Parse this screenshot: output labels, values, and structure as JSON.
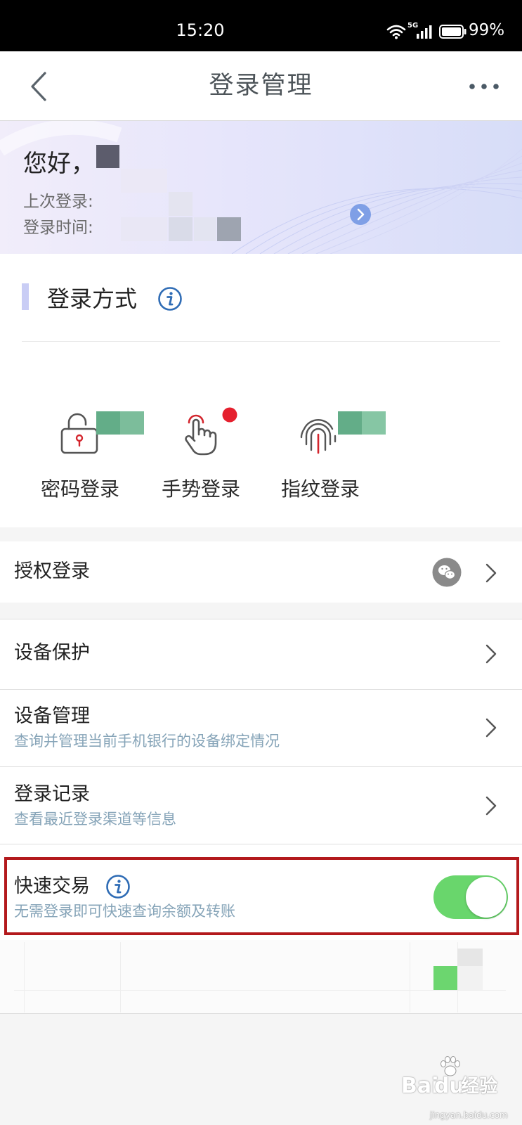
{
  "status_bar": {
    "time": "15:20",
    "network": "5G",
    "battery": "99%"
  },
  "header": {
    "title": "登录管理",
    "back_icon": "chevron-left-icon",
    "more_icon": "more-dots-icon"
  },
  "banner": {
    "greeting": "您好，",
    "last_login_label": "上次登录:",
    "login_time_label": "登录时间:"
  },
  "login_methods": {
    "title": "登录方式",
    "items": [
      {
        "label": "密码登录",
        "icon": "lock-icon"
      },
      {
        "label": "手势登录",
        "icon": "gesture-hand-icon",
        "badge": true
      },
      {
        "label": "指纹登录",
        "icon": "fingerprint-icon"
      }
    ]
  },
  "authorized_login": {
    "label": "授权登录",
    "icon": "wechat-icon"
  },
  "settings": [
    {
      "title": "设备保护"
    },
    {
      "title": "设备管理",
      "subtitle": "查询并管理当前手机银行的设备绑定情况"
    },
    {
      "title": "登录记录",
      "subtitle": "查看最近登录渠道等信息"
    }
  ],
  "quick_trade": {
    "title": "快速交易",
    "subtitle": "无需登录即可快速查询余额及转账",
    "enabled": true
  },
  "watermark": {
    "brand_left": "Bai",
    "brand_right": "du",
    "product": "经验",
    "url": "jingyan.baidu.com"
  },
  "colors": {
    "toggle_on": "#69d66c",
    "highlight_box": "#b3191c",
    "info_blue": "#2f6cb5",
    "badge_red": "#e5202e",
    "subtitle": "#86a4b8"
  }
}
